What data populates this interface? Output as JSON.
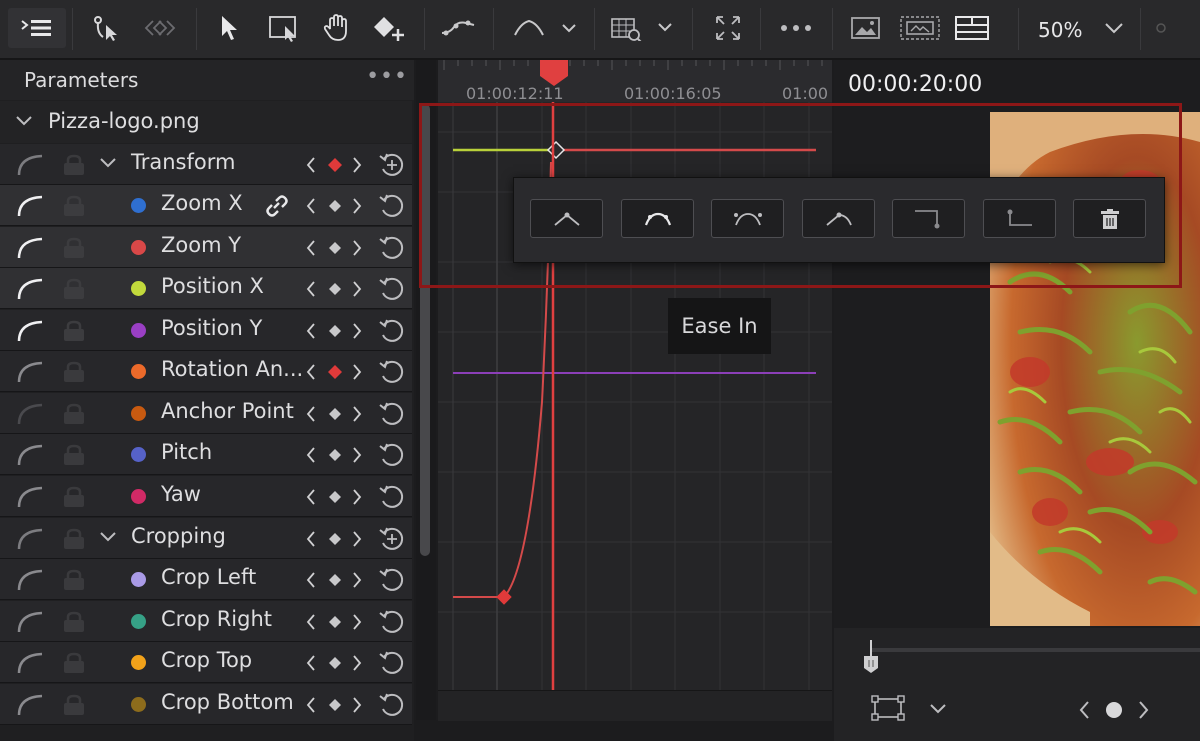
{
  "toolbar": {
    "zoom": "50%"
  },
  "params": {
    "title": "Parameters",
    "file": "Pizza-logo.png",
    "groups": {
      "transform": "Transform",
      "cropping": "Cropping"
    },
    "items": [
      {
        "name": "Zoom X",
        "color": "#2f6fd0"
      },
      {
        "name": "Zoom Y",
        "color": "#d94848"
      },
      {
        "name": "Position X",
        "color": "#c2d93c"
      },
      {
        "name": "Position Y",
        "color": "#9a3fc4"
      },
      {
        "name": "Rotation An...",
        "color": "#ec6a2a"
      },
      {
        "name": "Anchor Point",
        "color": "#c85a10"
      },
      {
        "name": "Pitch",
        "color": "#5662c8"
      },
      {
        "name": "Yaw",
        "color": "#d12a66"
      },
      {
        "name": "Crop Left",
        "color": "#a99ae6"
      },
      {
        "name": "Crop Right",
        "color": "#36a186"
      },
      {
        "name": "Crop Top",
        "color": "#f2a21a"
      },
      {
        "name": "Crop Bottom",
        "color": "#8d6c1c"
      }
    ]
  },
  "ruler": {
    "t1": "01:00:12:11",
    "t2": "01:00:16:05",
    "t3": "01:00"
  },
  "viewer": {
    "timecode": "00:00:20:00"
  },
  "tooltip": "Ease In",
  "colors": {
    "playhead": "#e04040",
    "highlight": "#8d1717"
  }
}
